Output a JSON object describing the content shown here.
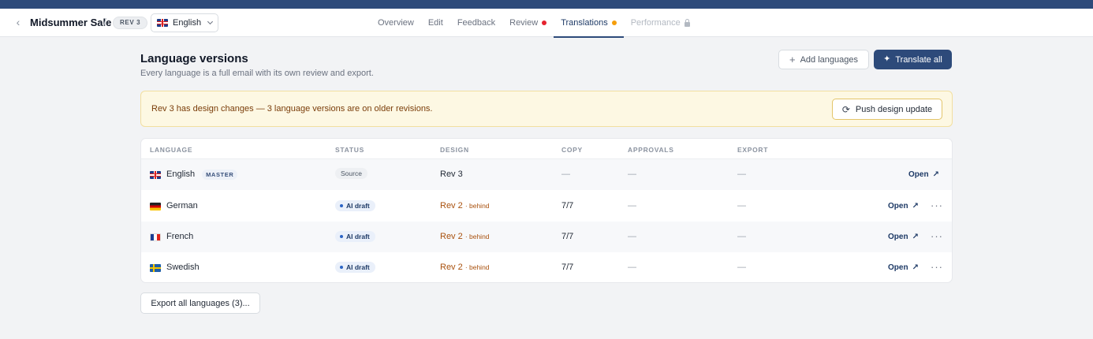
{
  "header": {
    "back_icon": "chevron-left-icon",
    "campaign_name": "Midsummer Sale",
    "separator": "/",
    "revision_badge": "REV 3",
    "language_selector": {
      "flag": "gb",
      "label": "English"
    },
    "tabs": [
      {
        "label": "Overview",
        "state": "normal"
      },
      {
        "label": "Edit",
        "state": "normal"
      },
      {
        "label": "Feedback",
        "state": "normal"
      },
      {
        "label": "Review",
        "state": "normal",
        "indicator_color": "#e5222e"
      },
      {
        "label": "Translations",
        "state": "active",
        "indicator_color": "#f59e0b"
      },
      {
        "label": "Performance",
        "state": "disabled",
        "icon": "lock-icon"
      }
    ]
  },
  "page": {
    "title": "Language versions",
    "subtitle": "Every language is a full email with its own review and export.",
    "add_languages_label": "Add languages",
    "translate_all_label": "Translate all"
  },
  "alert": {
    "message": "Rev 3 has design changes — 3 language versions are on older revisions.",
    "action_label": "Push design update"
  },
  "table": {
    "columns": [
      "LANGUAGE",
      "STATUS",
      "DESIGN",
      "COPY",
      "APPROVALS",
      "EXPORT"
    ],
    "rows": [
      {
        "flag": "gb",
        "language": "English",
        "tag": "MASTER",
        "status": "Source",
        "design": "Rev 3",
        "design_note": "",
        "copy": "—",
        "approvals": "—",
        "export": "—",
        "open_label": "Open",
        "has_menu": false
      },
      {
        "flag": "de",
        "language": "German",
        "tag": "",
        "status": "AI draft",
        "design": "Rev 2",
        "design_note": "· behind",
        "copy": "7/7",
        "approvals": "—",
        "export": "—",
        "open_label": "Open",
        "has_menu": true
      },
      {
        "flag": "fr",
        "language": "French",
        "tag": "",
        "status": "AI draft",
        "design": "Rev 2",
        "design_note": "· behind",
        "copy": "7/7",
        "approvals": "—",
        "export": "—",
        "open_label": "Open",
        "has_menu": true
      },
      {
        "flag": "se",
        "language": "Swedish",
        "tag": "",
        "status": "AI draft",
        "design": "Rev 2",
        "design_note": "· behind",
        "copy": "7/7",
        "approvals": "—",
        "export": "—",
        "open_label": "Open",
        "has_menu": true
      }
    ]
  },
  "footer": {
    "export_all_label": "Export all languages (3)..."
  },
  "colors": {
    "brand": "#2d4a7a",
    "alert_bg": "#fdf8e3",
    "behind": "#a9510e"
  }
}
